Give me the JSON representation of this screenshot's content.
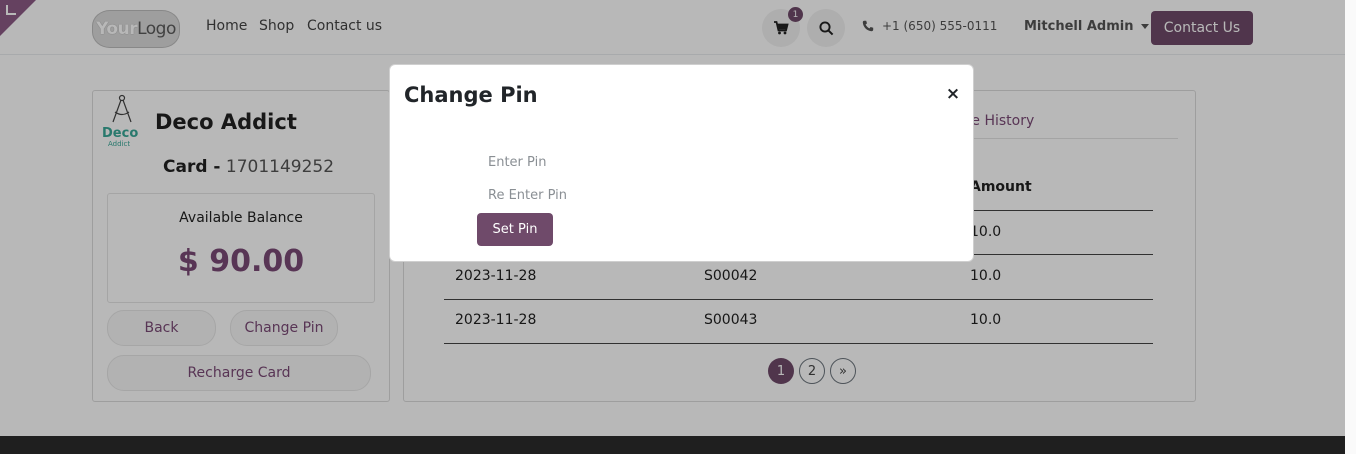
{
  "header": {
    "logo_part1": "Your",
    "logo_part2": "Logo",
    "nav": [
      "Home",
      "Shop",
      "Contact us"
    ],
    "cart_count": "1",
    "phone": "+1 (650) 555-0111",
    "user": "Mitchell Admin",
    "contact_button": "Contact Us",
    "accent_color": "#6f4a6a"
  },
  "left_card": {
    "logo_text": "Deco",
    "logo_sub": "Addict",
    "company": "Deco Addict",
    "card_label": "Card -",
    "card_number": "1701149252",
    "balance_title": "Available Balance",
    "balance_amount": "$ 90.00",
    "buttons": {
      "back": "Back",
      "change_pin": "Change Pin",
      "recharge": "Recharge Card"
    }
  },
  "right_card": {
    "tab_recharge": "rge History",
    "amount_header": "Amount",
    "rows": [
      {
        "date": "",
        "order": "",
        "amount": "10.0"
      },
      {
        "date": "2023-11-28",
        "order": "S00042",
        "amount": "10.0"
      },
      {
        "date": "2023-11-28",
        "order": "S00043",
        "amount": "10.0"
      }
    ],
    "pages": [
      "1",
      "2",
      "»"
    ]
  },
  "modal": {
    "title": "Change Pin",
    "close": "×",
    "enter_pin_placeholder": "Enter Pin",
    "reenter_pin_placeholder": "Re Enter Pin",
    "set_pin": "Set Pin"
  }
}
